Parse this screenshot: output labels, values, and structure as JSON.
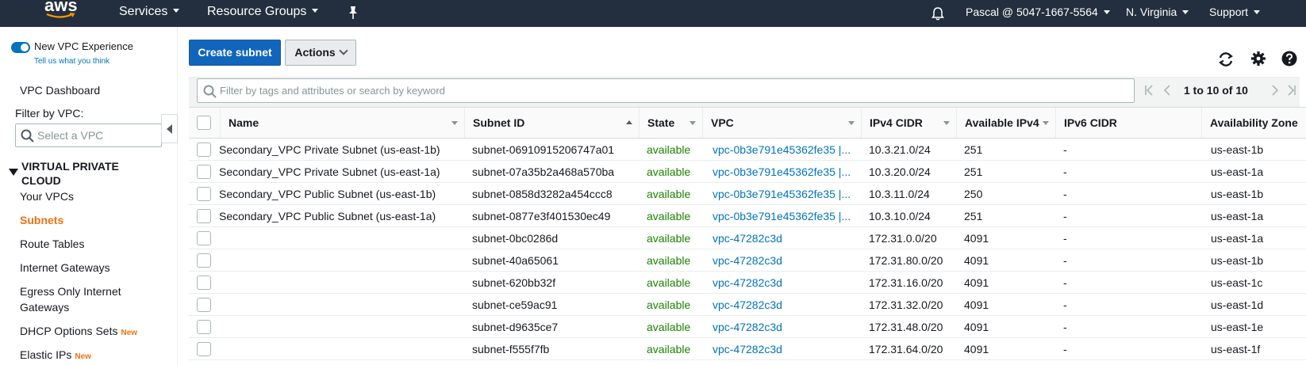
{
  "topnav": {
    "logo_text": "aws",
    "services": "Services",
    "resource_groups": "Resource Groups",
    "account": "Pascal @ 5047-1667-5564",
    "region": "N. Virginia",
    "support": "Support"
  },
  "sidebar": {
    "new_vpc_experience": "New VPC Experience",
    "tell_us": "Tell us what you think",
    "vpc_dashboard": "VPC Dashboard",
    "filter_by_vpc": "Filter by VPC:",
    "select_vpc_placeholder": "Select a VPC",
    "section_title_line1": "VIRTUAL PRIVATE",
    "section_title_line2": "CLOUD",
    "items": [
      {
        "label": "Your VPCs"
      },
      {
        "label": "Subnets"
      },
      {
        "label": "Route Tables"
      },
      {
        "label": "Internet Gateways"
      },
      {
        "label": "Egress Only Internet"
      },
      {
        "label": "Gateways"
      },
      {
        "label": "DHCP Options Sets",
        "badge": "New"
      },
      {
        "label": "Elastic IPs",
        "badge": "New"
      }
    ]
  },
  "toolbar": {
    "create_label": "Create subnet",
    "actions_label": "Actions"
  },
  "search": {
    "placeholder": "Filter by tags and attributes or search by keyword"
  },
  "pager": {
    "range": "1 to 10 of 10"
  },
  "table": {
    "columns": [
      "Name",
      "Subnet ID",
      "State",
      "VPC",
      "IPv4 CIDR",
      "Available IPv4",
      "IPv6 CIDR",
      "Availability Zone"
    ],
    "rows": [
      {
        "name": "Secondary_VPC Private Subnet (us-east-1b)",
        "subnet_id": "subnet-06910915206747a01",
        "state": "available",
        "vpc": "vpc-0b3e791e45362fe35 |...",
        "ipv4": "10.3.21.0/24",
        "avail": "251",
        "ipv6": "-",
        "az": "us-east-1b"
      },
      {
        "name": "Secondary_VPC Private Subnet (us-east-1a)",
        "subnet_id": "subnet-07a35b2a468a570ba",
        "state": "available",
        "vpc": "vpc-0b3e791e45362fe35 |...",
        "ipv4": "10.3.20.0/24",
        "avail": "251",
        "ipv6": "-",
        "az": "us-east-1a"
      },
      {
        "name": "Secondary_VPC Public Subnet (us-east-1b)",
        "subnet_id": "subnet-0858d3282a454ccc8",
        "state": "available",
        "vpc": "vpc-0b3e791e45362fe35 |...",
        "ipv4": "10.3.11.0/24",
        "avail": "250",
        "ipv6": "-",
        "az": "us-east-1b"
      },
      {
        "name": "Secondary_VPC Public Subnet (us-east-1a)",
        "subnet_id": "subnet-0877e3f401530ec49",
        "state": "available",
        "vpc": "vpc-0b3e791e45362fe35 |...",
        "ipv4": "10.3.10.0/24",
        "avail": "251",
        "ipv6": "-",
        "az": "us-east-1a"
      },
      {
        "name": "",
        "subnet_id": "subnet-0bc0286d",
        "state": "available",
        "vpc": "vpc-47282c3d",
        "ipv4": "172.31.0.0/20",
        "avail": "4091",
        "ipv6": "-",
        "az": "us-east-1a"
      },
      {
        "name": "",
        "subnet_id": "subnet-40a65061",
        "state": "available",
        "vpc": "vpc-47282c3d",
        "ipv4": "172.31.80.0/20",
        "avail": "4091",
        "ipv6": "-",
        "az": "us-east-1b"
      },
      {
        "name": "",
        "subnet_id": "subnet-620bb32f",
        "state": "available",
        "vpc": "vpc-47282c3d",
        "ipv4": "172.31.16.0/20",
        "avail": "4091",
        "ipv6": "-",
        "az": "us-east-1c"
      },
      {
        "name": "",
        "subnet_id": "subnet-ce59ac91",
        "state": "available",
        "vpc": "vpc-47282c3d",
        "ipv4": "172.31.32.0/20",
        "avail": "4091",
        "ipv6": "-",
        "az": "us-east-1d"
      },
      {
        "name": "",
        "subnet_id": "subnet-d9635ce7",
        "state": "available",
        "vpc": "vpc-47282c3d",
        "ipv4": "172.31.48.0/20",
        "avail": "4091",
        "ipv6": "-",
        "az": "us-east-1e"
      },
      {
        "name": "",
        "subnet_id": "subnet-f555f7fb",
        "state": "available",
        "vpc": "vpc-47282c3d",
        "ipv4": "172.31.64.0/20",
        "avail": "4091",
        "ipv6": "-",
        "az": "us-east-1f"
      }
    ]
  },
  "colors": {
    "nav_bg": "#232f3e",
    "primary": "#1166bb",
    "active_orange": "#ec7211",
    "available_green": "#1d8102",
    "link_blue": "#0073bb"
  }
}
